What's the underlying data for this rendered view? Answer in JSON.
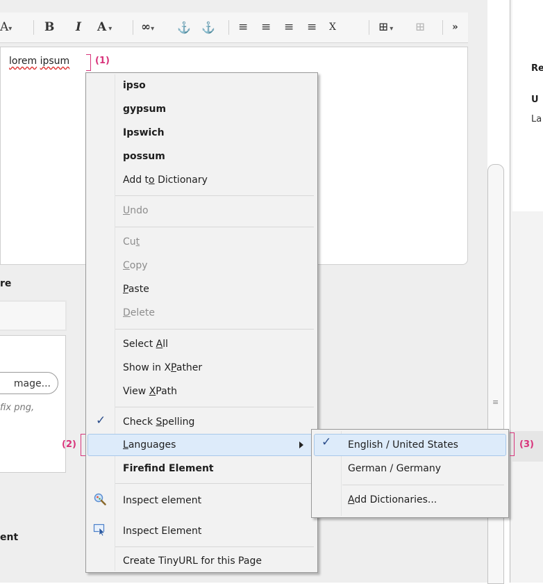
{
  "editor": {
    "toolbar": {
      "font_size_glyph": "A",
      "font_size_caret": "▾",
      "bold": "B",
      "italic": "I",
      "font_color_glyph": "A",
      "font_color_caret": "▾",
      "link_glyph": "∞",
      "link_caret": "▾",
      "anchor_glyph": "⚓",
      "unlink_glyph": "⚓",
      "align_left": "≡",
      "align_center": "≡",
      "align_right": "≡",
      "align_justify": "≡",
      "clear_format": "Ⅹ",
      "table_glyph": "⊞",
      "table_caret": "▾",
      "table_props_glyph": "⊞",
      "more": "»"
    },
    "content": {
      "word_1": "lorem",
      "word_2": "ipsum"
    },
    "section_label_1": "re",
    "image_button": "mage...",
    "hint_lines": [
      "fix png,",
      ""
    ],
    "section_label_2": "ent",
    "scroll_grip": "≡"
  },
  "right_pane": {
    "line_1": "Re",
    "line_2": "U",
    "line_3": "La"
  },
  "callouts": {
    "c1": "(1)",
    "c2": "(2)",
    "c3": "(3)"
  },
  "context_menu": {
    "suggestions": [
      "ipso",
      "gypsum",
      "Ipswich",
      "possum"
    ],
    "add_to_dictionary": {
      "pre": "Add t",
      "key": "o",
      "post": " Dictionary"
    },
    "undo": {
      "pre": "",
      "key": "U",
      "post": "ndo"
    },
    "cut": {
      "pre": "Cu",
      "key": "t",
      "post": ""
    },
    "copy": {
      "pre": "",
      "key": "C",
      "post": "opy"
    },
    "paste": {
      "pre": "",
      "key": "P",
      "post": "aste"
    },
    "delete": {
      "pre": "",
      "key": "D",
      "post": "elete"
    },
    "select_all": {
      "pre": "Select ",
      "key": "A",
      "post": "ll"
    },
    "show_in_xpather": {
      "pre": "Show in X",
      "key": "P",
      "post": "ather"
    },
    "view_xpath": {
      "pre": "View ",
      "key": "X",
      "post": "Path"
    },
    "check_spelling": {
      "pre": "Check ",
      "key": "S",
      "post": "pelling",
      "checked": true
    },
    "languages": {
      "pre": "",
      "key": "L",
      "post": "anguages"
    },
    "firefind_element": "Firefind Element",
    "inspect_element_1": "Inspect element",
    "inspect_element_2": "Inspect Element",
    "create_tinyurl": "Create TinyURL for this Page"
  },
  "languages_submenu": {
    "items": [
      "English / United States",
      "German / Germany"
    ],
    "selected_index": 0,
    "add_dictionaries": {
      "pre": "",
      "key": "A",
      "post": "dd Dictionaries..."
    }
  },
  "colors": {
    "callout": "#d8347b",
    "menu_highlight": "#ddebfa",
    "check": "#2a4c8a"
  }
}
